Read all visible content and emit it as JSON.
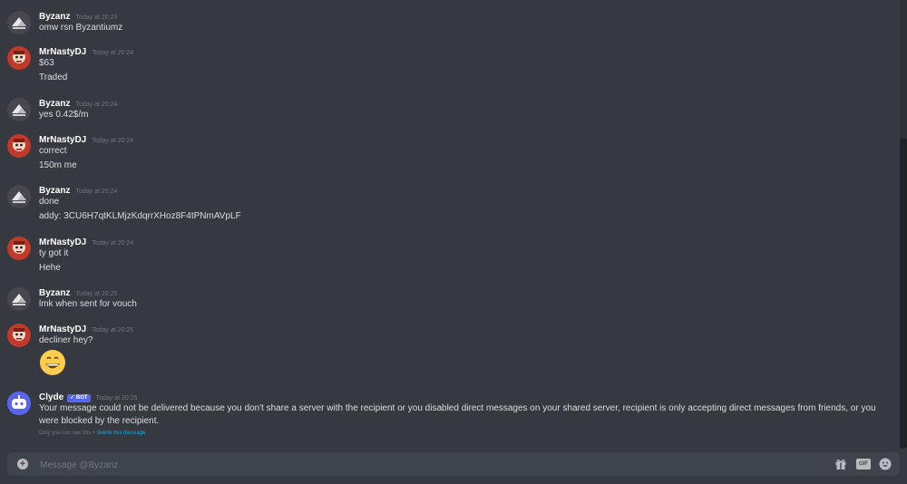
{
  "messages": [
    {
      "author": "Byzanz",
      "avatar": "byzanz",
      "time": "Today at 20:23",
      "lines": [
        "omw rsn Byzantiumz"
      ]
    },
    {
      "author": "MrNastyDJ",
      "avatar": "mrnasty",
      "time": "Today at 20:24",
      "lines": [
        "$63",
        "Traded"
      ]
    },
    {
      "author": "Byzanz",
      "avatar": "byzanz",
      "time": "Today at 20:24",
      "lines": [
        "yes 0.42$/m"
      ]
    },
    {
      "author": "MrNastyDJ",
      "avatar": "mrnasty",
      "time": "Today at 20:24",
      "lines": [
        "correct",
        "150m me"
      ]
    },
    {
      "author": "Byzanz",
      "avatar": "byzanz",
      "time": "Today at 20:24",
      "lines": [
        "done",
        "addy: 3CU6H7qtKLMjzKdqrrXHoz8F4tPNmAVpLF"
      ]
    },
    {
      "author": "MrNastyDJ",
      "avatar": "mrnasty",
      "time": "Today at 20:24",
      "lines": [
        "ty got it",
        "Hehe"
      ]
    },
    {
      "author": "Byzanz",
      "avatar": "byzanz",
      "time": "Today at 20:25",
      "lines": [
        "lmk when sent for vouch"
      ]
    },
    {
      "author": "MrNastyDJ",
      "avatar": "mrnasty",
      "time": "Today at 20:25",
      "lines": [
        "decliner hey?"
      ],
      "emoji": "grinning-face-emoji"
    }
  ],
  "clyde": {
    "author": "Clyde",
    "badge": "✓ BOT",
    "time": "Today at 20:25",
    "text": "Your message could not be delivered because you don't share a server with the recipient or you disabled direct messages on your shared server, recipient is only accepting direct messages from friends, or you were blocked by the recipient.",
    "ephemeral_note": "Only you can see this •",
    "dismiss_label": "delete this message"
  },
  "composer": {
    "placeholder": "Message @Byzanz",
    "add_icon": "plus-circle-icon",
    "gift_icon": "gift-icon",
    "gif_label": "GIF",
    "emoji_icon": "smile-icon"
  },
  "colors": {
    "background": "#36393f",
    "input": "#40444b",
    "bot_badge": "#5865f2",
    "link": "#00aff4"
  }
}
